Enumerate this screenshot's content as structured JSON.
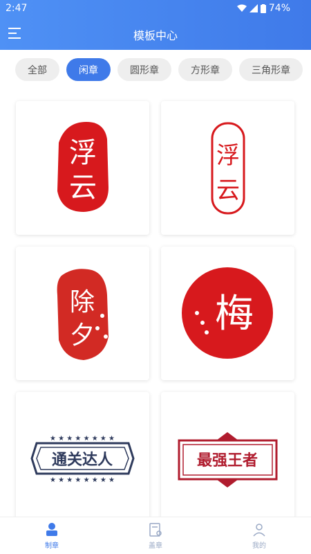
{
  "status": {
    "time": "2:47",
    "battery": "74%"
  },
  "header": {
    "title": "模板中心"
  },
  "filters": [
    "全部",
    "闲章",
    "圆形章",
    "方形章",
    "三角形章"
  ],
  "active_filter": "闲章",
  "templates": [
    {
      "text_line1": "浮",
      "text_line2": "云",
      "style": "solid-red-oval"
    },
    {
      "text_line1": "浮",
      "text_line2": "云",
      "style": "outline-red-oval"
    },
    {
      "text_line1": "除",
      "text_line2": "夕",
      "style": "red-blob-plum"
    },
    {
      "text_line1": "梅",
      "style": "red-circle-plum"
    },
    {
      "text": "通关达人",
      "style": "navy-banner"
    },
    {
      "text": "最强王者",
      "style": "red-banner"
    }
  ],
  "tabbar": [
    {
      "label": "制章",
      "active": true
    },
    {
      "label": "盖章",
      "active": false
    },
    {
      "label": "我的",
      "active": false
    }
  ],
  "colors": {
    "accent": "#3f7ae9",
    "seal_red": "#d7191d",
    "navy": "#2e3a5c"
  }
}
